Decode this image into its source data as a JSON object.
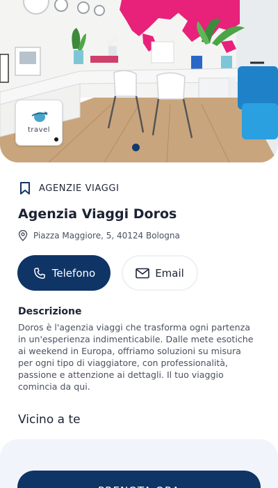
{
  "hero": {
    "logo_text": "travel",
    "active_slide": 1,
    "total_slides": 1
  },
  "category": {
    "icon": "bookmark-icon",
    "label": "AGENZIE VIAGGI"
  },
  "business": {
    "name": "Agenzia Viaggi Doros",
    "address": "Piazza Maggiore, 5, 40124 Bologna"
  },
  "actions": {
    "phone_label": "Telefono",
    "email_label": "Email"
  },
  "description": {
    "heading": "Descrizione",
    "text": "Doros è l'agenzia viaggi che trasforma ogni partenza in un'esperienza indimenticabile. Dalle mete esotiche ai weekend in Europa, offriamo soluzioni su misura per ogni tipo di viaggiatore, con professionalità, passione e attenzione ai dettagli. Il tuo viaggio comincia da qui."
  },
  "nearby": {
    "heading": "Vicino a te"
  },
  "cta": {
    "label": "PRENOTA ORA"
  },
  "colors": {
    "primary": "#0f3466",
    "panel": "#f1f4fa",
    "text": "#1b2233",
    "muted": "#4a5060"
  }
}
